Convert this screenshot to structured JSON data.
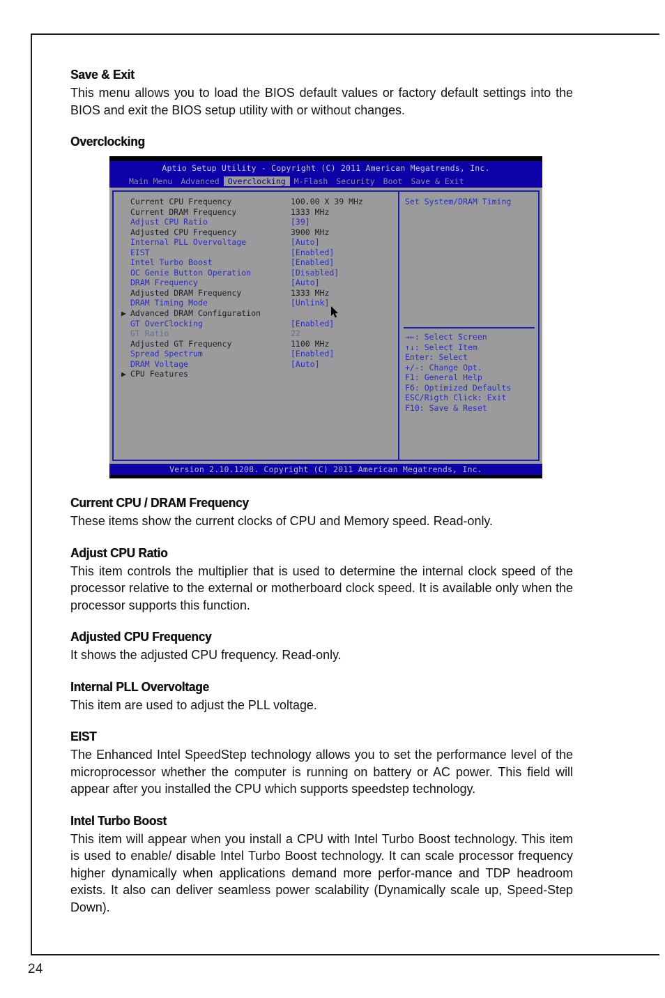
{
  "page": {
    "number": "24"
  },
  "sections": [
    {
      "heading": "Save & Exit",
      "body": "This menu allows you to load the BIOS default values or factory default settings into the BIOS and exit the BIOS setup utility with or without changes."
    },
    {
      "heading": "Overclocking",
      "body": ""
    },
    {
      "heading": "Current CPU / DRAM Frequency",
      "body": "These items show the current clocks of CPU and Memory speed. Read-only."
    },
    {
      "heading": "Adjust CPU Ratio",
      "body": "This item controls the multiplier that is used to determine the internal clock speed of the processor relative to the external or motherboard clock speed. It is available only when the processor supports this function."
    },
    {
      "heading": "Adjusted CPU Frequency",
      "body": "It shows the adjusted CPU frequency. Read-only."
    },
    {
      "heading": "Internal PLL Overvoltage",
      "body": "This item are used to adjust the PLL voltage."
    },
    {
      "heading": "EIST",
      "body": "The Enhanced Intel SpeedStep technology allows you to set the performance level of the microprocessor whether the computer is running on battery or AC power. This field will appear after you installed the CPU which supports speedstep technology."
    },
    {
      "heading": "Intel Turbo Boost",
      "body": "This item will appear when you install a CPU with Intel Turbo Boost technology. This item is used to enable/ disable Intel Turbo Boost technology. It can scale processor frequency higher dynamically when applications demand more perfor-mance and TDP headroom exists. It also can deliver seamless power scalability (Dynamically scale up, Speed-Step Down)."
    }
  ],
  "bios": {
    "title": "Aptio Setup Utility - Copyright (C) 2011 American Megatrends, Inc.",
    "menu": [
      {
        "label": "Main Menu",
        "active": false
      },
      {
        "label": "Advanced",
        "active": false
      },
      {
        "label": "Overclocking",
        "active": true
      },
      {
        "label": "M-Flash",
        "active": false
      },
      {
        "label": "Security",
        "active": false
      },
      {
        "label": "Boot",
        "active": false
      },
      {
        "label": "Save & Exit",
        "active": false
      }
    ],
    "items": [
      {
        "label": "Current CPU Frequency",
        "value": "100.00 X 39 MHz",
        "label_style": "dark",
        "value_style": "dark",
        "submenu": false
      },
      {
        "label": "Current DRAM Frequency",
        "value": "1333 MHz",
        "label_style": "dark",
        "value_style": "dark",
        "submenu": false
      },
      {
        "label": "Adjust CPU Ratio",
        "value": "[39]",
        "label_style": "blue",
        "value_style": "blue",
        "submenu": false
      },
      {
        "label": "Adjusted CPU Frequency",
        "value": "3900 MHz",
        "label_style": "dark",
        "value_style": "dark",
        "submenu": false
      },
      {
        "label": "Internal PLL Overvoltage",
        "value": "[Auto]",
        "label_style": "blue",
        "value_style": "blue",
        "submenu": false
      },
      {
        "label": "EIST",
        "value": "[Enabled]",
        "label_style": "blue",
        "value_style": "blue",
        "submenu": false
      },
      {
        "label": "Intel Turbo Boost",
        "value": "[Enabled]",
        "label_style": "blue",
        "value_style": "blue",
        "submenu": false
      },
      {
        "label": "OC Genie Button Operation",
        "value": "[Disabled]",
        "label_style": "blue",
        "value_style": "blue",
        "submenu": false
      },
      {
        "label": "DRAM Frequency",
        "value": "[Auto]",
        "label_style": "blue",
        "value_style": "blue",
        "submenu": false
      },
      {
        "label": "Adjusted DRAM Frequency",
        "value": "1333 MHz",
        "label_style": "dark",
        "value_style": "dark",
        "submenu": false
      },
      {
        "label": "DRAM Timing Mode",
        "value": "[Unlink]",
        "label_style": "blue",
        "value_style": "blue",
        "submenu": false
      },
      {
        "label": "Advanced DRAM Configuration",
        "value": "",
        "label_style": "dark",
        "value_style": "dark",
        "submenu": true
      },
      {
        "label": "GT OverClocking",
        "value": "[Enabled]",
        "label_style": "blue",
        "value_style": "blue",
        "submenu": false
      },
      {
        "label": "GT Ratio",
        "value": "22",
        "label_style": "grayed",
        "value_style": "grayed",
        "submenu": false
      },
      {
        "label": "Adjusted GT Frequency",
        "value": "1100 MHz",
        "label_style": "dark",
        "value_style": "dark",
        "submenu": false
      },
      {
        "label": "Spread Spectrum",
        "value": "[Enabled]",
        "label_style": "blue",
        "value_style": "blue",
        "submenu": false
      },
      {
        "label": "DRAM Voltage",
        "value": "[Auto]",
        "label_style": "blue",
        "value_style": "blue",
        "submenu": false
      },
      {
        "label": "CPU Features",
        "value": "",
        "label_style": "dark",
        "value_style": "dark",
        "submenu": true
      }
    ],
    "help_text": "Set System/DRAM Timing",
    "keys": [
      "→←: Select Screen",
      "↑↓: Select Item",
      "Enter: Select",
      "+/-: Change Opt.",
      "F1: General Help",
      "F6: Optimized Defaults",
      "ESC/Rigth Click: Exit",
      "F10: Save & Reset"
    ],
    "footer": "Version 2.10.1208. Copyright (C) 2011 American Megatrends, Inc.",
    "colors": {
      "header_blue": "#0d00a6",
      "body_gray": "#9b9b9e",
      "text_blue": "#2b2bbe",
      "text_dark": "#202020",
      "border_blue": "#1a1ab0"
    }
  }
}
